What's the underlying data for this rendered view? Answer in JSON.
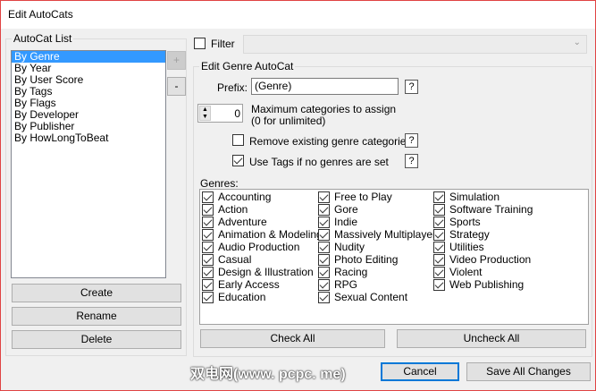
{
  "window": {
    "title": "Edit AutoCats"
  },
  "autocat_list": {
    "label": "AutoCat List",
    "items": [
      "By Genre",
      "By Year",
      "By User Score",
      "By Tags",
      "By Flags",
      "By Developer",
      "By Publisher",
      "By HowLongToBeat"
    ],
    "selected": 0,
    "add_label": "+",
    "remove_label": "-",
    "create_label": "Create",
    "rename_label": "Rename",
    "delete_label": "Delete"
  },
  "filter": {
    "label": "Filter",
    "checked": false,
    "value": ""
  },
  "edit": {
    "label": "Edit Genre AutoCat",
    "prefix_label": "Prefix:",
    "prefix_value": "(Genre)",
    "help": "?",
    "max_value": "0",
    "max_label_1": "Maximum categories to assign",
    "max_label_2": "(0 for unlimited)",
    "remove_label": "Remove existing genre categories",
    "remove_checked": false,
    "usetags_label": "Use Tags if no genres are set",
    "usetags_checked": true,
    "genres_label": "Genres:",
    "genres": [
      [
        "Accounting",
        "Action",
        "Adventure",
        "Animation & Modeling",
        "Audio Production",
        "Casual",
        "Design & Illustration",
        "Early Access",
        "Education"
      ],
      [
        "Free to Play",
        "Gore",
        "Indie",
        "Massively Multiplayer",
        "Nudity",
        "Photo Editing",
        "Racing",
        "RPG",
        "Sexual Content"
      ],
      [
        "Simulation",
        "Software Training",
        "Sports",
        "Strategy",
        "Utilities",
        "Video Production",
        "Violent",
        "Web Publishing"
      ]
    ],
    "check_all": "Check All",
    "uncheck_all": "Uncheck All"
  },
  "footer": {
    "watermark": "双电网(www. pcpc. me)",
    "cancel": "Cancel",
    "save": "Save All Changes"
  },
  "colors": {
    "selection": "#3399ff",
    "focus": "#0078d7",
    "border": "#e04343"
  }
}
